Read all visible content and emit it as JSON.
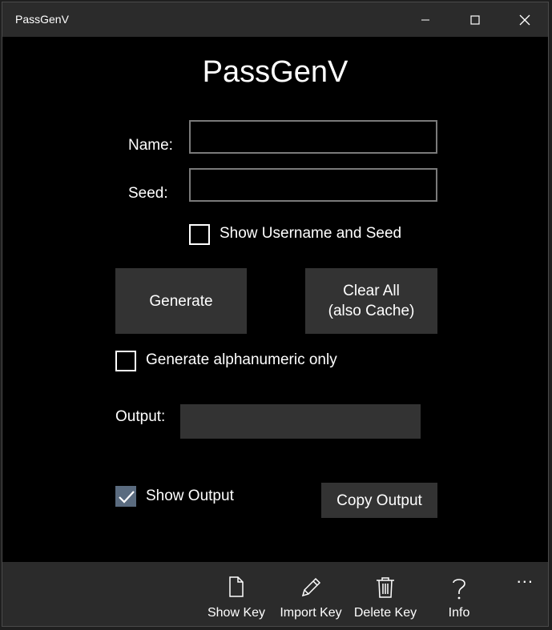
{
  "window": {
    "title": "PassGenV",
    "controls": {
      "minimize_icon": "minimize-icon",
      "maximize_icon": "maximize-icon",
      "close_icon": "close-icon"
    }
  },
  "main": {
    "heading": "PassGenV",
    "name_label": "Name:",
    "name_value": "",
    "seed_label": "Seed:",
    "seed_value": "",
    "show_username_seed": {
      "label": "Show Username and Seed",
      "checked": false
    },
    "generate_button": "Generate",
    "clear_button_line1": "Clear All",
    "clear_button_line2": "(also Cache)",
    "alphanumeric": {
      "label": "Generate alphanumeric only",
      "checked": false
    },
    "output_label": "Output:",
    "output_value": "",
    "show_output": {
      "label": "Show Output",
      "checked": true
    },
    "copy_output_button": "Copy Output"
  },
  "appbar": {
    "more": "...",
    "buttons": [
      {
        "label": "Show Key",
        "icon": "document-icon"
      },
      {
        "label": "Import Key",
        "icon": "pencil-icon"
      },
      {
        "label": "Delete Key",
        "icon": "trash-icon"
      },
      {
        "label": "Info",
        "icon": "question-icon"
      }
    ]
  },
  "colors": {
    "background": "#000000",
    "titlebar": "#2b2b2b",
    "button": "#333333",
    "checkbox_checked": "#5a6b7f",
    "textbox_border": "#7a7a7a"
  }
}
